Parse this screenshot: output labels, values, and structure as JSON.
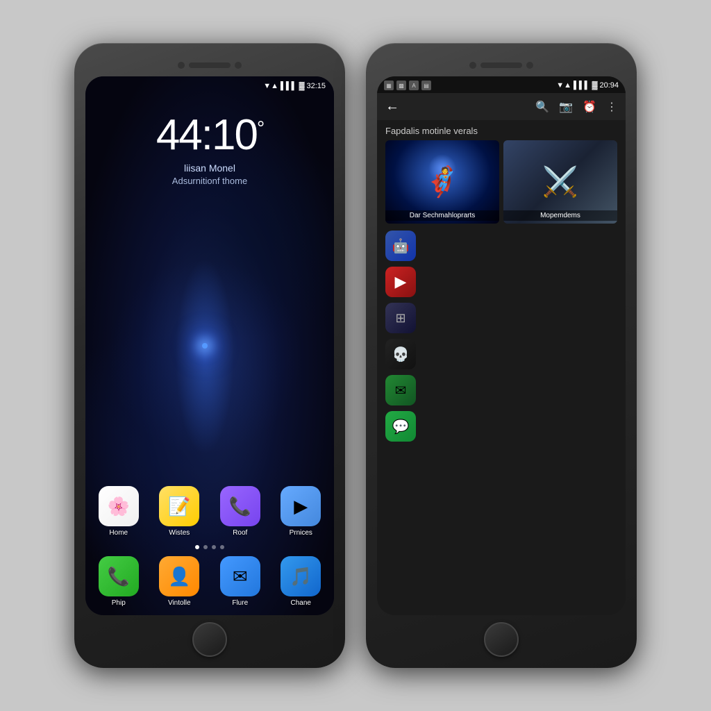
{
  "left_phone": {
    "status_bar": {
      "time": "32:15",
      "icons": [
        "▼",
        "▲",
        "▌▌",
        "█"
      ]
    },
    "clock": {
      "time": "44:10",
      "degree": "°",
      "line1": "liisan Monel",
      "line2": "Adsurnitionf thome"
    },
    "apps": [
      {
        "id": "home",
        "label": "Home",
        "icon": "🌸",
        "class": "app-photos"
      },
      {
        "id": "wistes",
        "label": "Wistes",
        "icon": "📝",
        "class": "app-notes"
      },
      {
        "id": "roof",
        "label": "Roof",
        "icon": "📞",
        "class": "app-phone"
      },
      {
        "id": "prnices",
        "label": "Prnices",
        "icon": "▶",
        "class": "app-play"
      }
    ],
    "dots": [
      true,
      false,
      false,
      false
    ],
    "dock": [
      {
        "id": "phip",
        "label": "Phip",
        "icon": "📞",
        "class": "app-icon-phone"
      },
      {
        "id": "vintolle",
        "label": "Vintolle",
        "icon": "👤",
        "class": "app-icon-contacts"
      },
      {
        "id": "flure",
        "label": "Flure",
        "icon": "✉",
        "class": "app-icon-mail"
      },
      {
        "id": "chane",
        "label": "Chane",
        "icon": "🎵",
        "class": "app-icon-music"
      }
    ]
  },
  "right_phone": {
    "status_bar": {
      "time": "20:94",
      "icons": [
        "▼",
        "▲",
        "▌▌",
        "█"
      ]
    },
    "nav": {
      "back": "←",
      "icons": [
        "🔍",
        "📷",
        "⏰",
        "⋮"
      ]
    },
    "section_title": "Fapdalis motinle verals",
    "games": [
      {
        "label": "Dar Sechmahloprarts",
        "bg_class": "game1-bg"
      },
      {
        "label": "Mopemdems",
        "bg_class": "game2-bg"
      }
    ],
    "app_list": [
      {
        "icon": "🤖",
        "class": "icon-robot"
      },
      {
        "icon": "▶",
        "class": "icon-play"
      },
      {
        "icon": "⊞",
        "class": "icon-grid"
      },
      {
        "icon": "💀",
        "class": "icon-skull"
      },
      {
        "icon": "✉",
        "class": "icon-message"
      },
      {
        "icon": "💬",
        "class": "icon-whatsapp"
      }
    ]
  }
}
